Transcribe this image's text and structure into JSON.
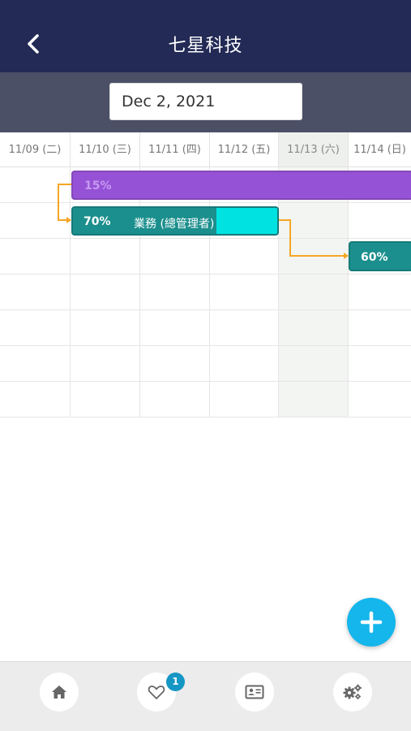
{
  "header": {
    "title": "七星科技"
  },
  "date_picker": {
    "value": "Dec 2, 2021"
  },
  "gantt": {
    "days": [
      {
        "label": "11/09 (二)",
        "weekend": false
      },
      {
        "label": "11/10 (三)",
        "weekend": false
      },
      {
        "label": "11/11 (四)",
        "weekend": false
      },
      {
        "label": "11/12 (五)",
        "weekend": false
      },
      {
        "label": "11/13 (六)",
        "weekend": true
      },
      {
        "label": "11/14 (日)",
        "weekend": false
      }
    ],
    "tasks": [
      {
        "progress_label": "15%",
        "progress": 0.15,
        "color": "#9652d6"
      },
      {
        "progress_label": "70%",
        "progress": 0.7,
        "name": "業務 (總管理者)",
        "color": "#1b8f8d",
        "remaining_color": "#00e2e2"
      },
      {
        "progress_label": "60%",
        "progress": 0.6,
        "color": "#1b8f8d"
      }
    ],
    "link_color": "#f5a623"
  },
  "fab": {
    "icon": "plus-icon",
    "color": "#14b6ec"
  },
  "tabbar": {
    "tabs": [
      {
        "icon": "home-icon"
      },
      {
        "icon": "heart-icon",
        "badge": "1"
      },
      {
        "icon": "contact-card-icon"
      },
      {
        "icon": "gears-icon"
      }
    ]
  }
}
